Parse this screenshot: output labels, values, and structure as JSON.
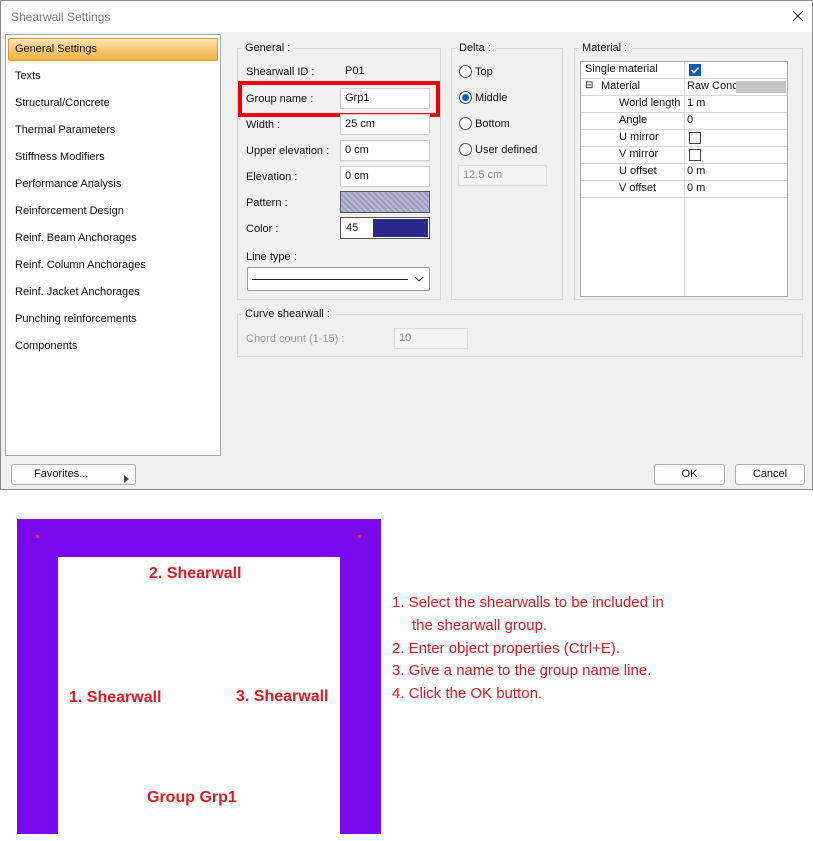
{
  "window": {
    "title": "Shearwall Settings"
  },
  "nav": {
    "items": [
      "General Settings",
      "Texts",
      "Structural/Concrete",
      "Thermal Parameters",
      "Stiffness Modifiers",
      "Performance Analysis",
      "Reinforcement Design",
      "Reinf. Beam Anchorages",
      "Reinf. Column Anchorages",
      "Reinf. Jacket Anchorages",
      "Punching reinforcements",
      "Components"
    ],
    "active_index": 0
  },
  "general": {
    "legend": "General :",
    "shearwall_id_label": "Shearwall ID :",
    "shearwall_id_value": "P01",
    "group_name_label": "Group name :",
    "group_name_value": "Grp1",
    "width_label": "Width :",
    "width_value": "25 cm",
    "upper_elevation_label": "Upper elevation :",
    "upper_elevation_value": "0 cm",
    "elevation_label": "Elevation :",
    "elevation_value": "0 cm",
    "pattern_label": "Pattern :",
    "color_label": "Color :",
    "color_value": "45",
    "color_swatch": "#2a2a8a",
    "line_type_label": "Line type :"
  },
  "delta": {
    "legend": "Delta :",
    "options": [
      "Top",
      "Middle",
      "Bottom",
      "User defined"
    ],
    "selected": "Middle",
    "user_value": "12.5 cm"
  },
  "material": {
    "legend": "Material :",
    "rows": [
      {
        "name": "Single material",
        "value": "",
        "checkbox": true,
        "checked": true
      },
      {
        "name": "Material",
        "value": "Raw Conc",
        "expander": "⊟"
      },
      {
        "name": "World length",
        "value": "1 m"
      },
      {
        "name": "Angle",
        "value": "0"
      },
      {
        "name": "U mirror",
        "value": "",
        "checkbox": true,
        "checked": false
      },
      {
        "name": "V mirror",
        "value": "",
        "checkbox": true,
        "checked": false
      },
      {
        "name": "U offset",
        "value": "0 m"
      },
      {
        "name": "V offset",
        "value": "0 m"
      }
    ]
  },
  "curve": {
    "legend": "Curve shearwall :",
    "chord_label": "Chord count (1-15) :",
    "chord_value": "10"
  },
  "footer": {
    "favorites": "Favorites...",
    "ok": "OK",
    "cancel": "Cancel"
  },
  "diagram": {
    "labels": {
      "wall2": "2. Shearwall",
      "wall1": "1. Shearwall",
      "wall3": "3. Shearwall",
      "group": "Group Grp1"
    },
    "frame_color": "#7a09f0",
    "label_color": "#e01a24"
  },
  "instructions": [
    "1. Select the shearwalls to be included in",
    "the shearwall group.",
    "2. Enter object properties (Ctrl+E).",
    "3. Give a name to the group name line.",
    "4. Click the OK button."
  ]
}
